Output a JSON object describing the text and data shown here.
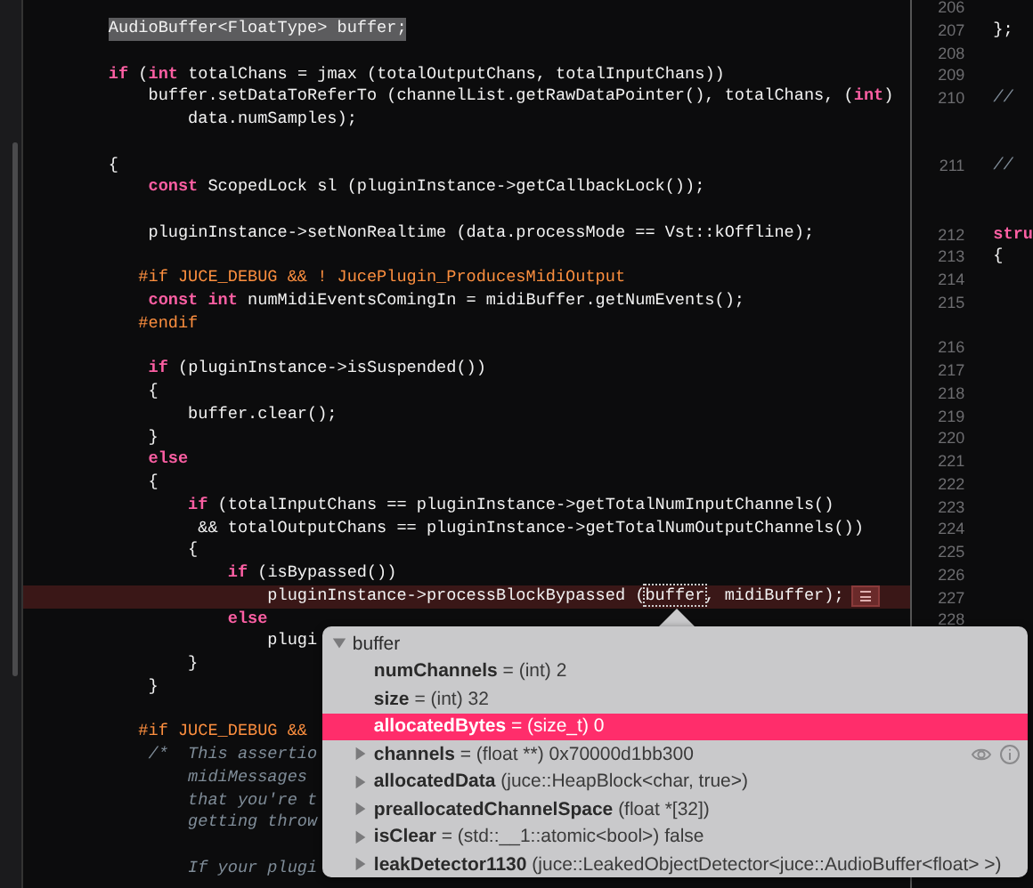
{
  "editor": {
    "lines": [
      {
        "kind": "selected",
        "segments": [
          {
            "kind": "plain",
            "text": "AudioBuffer<FloatType> buffer;"
          }
        ]
      },
      {
        "kind": "blank"
      },
      {
        "kind": "code",
        "segments": [
          {
            "kind": "keyword",
            "text": "if"
          },
          {
            "kind": "plain",
            "text": " ("
          },
          {
            "kind": "keyword",
            "text": "int"
          },
          {
            "kind": "plain",
            "text": " totalChans = jmax (totalOutputChans, totalInputChans))"
          }
        ]
      },
      {
        "kind": "code",
        "segments": [
          {
            "kind": "plain",
            "text": "    buffer.setDataToReferTo (channelList.getRawDataPointer(), totalChans, ("
          },
          {
            "kind": "keyword",
            "text": "int"
          },
          {
            "kind": "plain",
            "text": ")"
          }
        ]
      },
      {
        "kind": "code",
        "segments": [
          {
            "kind": "plain",
            "text": "        data.numSamples);"
          }
        ]
      },
      {
        "kind": "blank"
      },
      {
        "kind": "code",
        "segments": [
          {
            "kind": "plain",
            "text": "{"
          }
        ]
      },
      {
        "kind": "code",
        "segments": [
          {
            "kind": "keyword",
            "text": "    const"
          },
          {
            "kind": "plain",
            "text": " ScopedLock sl (pluginInstance->getCallbackLock());"
          }
        ]
      },
      {
        "kind": "blank"
      },
      {
        "kind": "code",
        "segments": [
          {
            "kind": "plain",
            "text": "    pluginInstance->setNonRealtime (data.processMode == Vst::kOffline);"
          }
        ]
      },
      {
        "kind": "blank"
      },
      {
        "kind": "code",
        "segments": [
          {
            "kind": "preprocessor",
            "text": "   #if JUCE_DEBUG && ! JucePlugin_ProducesMidiOutput"
          }
        ]
      },
      {
        "kind": "code",
        "segments": [
          {
            "kind": "keyword",
            "text": "    const int"
          },
          {
            "kind": "plain",
            "text": " numMidiEventsComingIn = midiBuffer.getNumEvents();"
          }
        ]
      },
      {
        "kind": "code",
        "segments": [
          {
            "kind": "preprocessor",
            "text": "   #endif"
          }
        ]
      },
      {
        "kind": "blank"
      },
      {
        "kind": "code",
        "segments": [
          {
            "kind": "keyword",
            "text": "    if"
          },
          {
            "kind": "plain",
            "text": " (pluginInstance->isSuspended())"
          }
        ]
      },
      {
        "kind": "code",
        "segments": [
          {
            "kind": "plain",
            "text": "    {"
          }
        ]
      },
      {
        "kind": "code",
        "segments": [
          {
            "kind": "plain",
            "text": "        buffer.clear();"
          }
        ]
      },
      {
        "kind": "code",
        "segments": [
          {
            "kind": "plain",
            "text": "    }"
          }
        ]
      },
      {
        "kind": "code",
        "segments": [
          {
            "kind": "keyword",
            "text": "    else"
          }
        ]
      },
      {
        "kind": "code",
        "segments": [
          {
            "kind": "plain",
            "text": "    {"
          }
        ]
      },
      {
        "kind": "code",
        "segments": [
          {
            "kind": "keyword",
            "text": "        if"
          },
          {
            "kind": "plain",
            "text": " (totalInputChans == pluginInstance->getTotalNumInputChannels()"
          }
        ]
      },
      {
        "kind": "code",
        "segments": [
          {
            "kind": "plain",
            "text": "         && totalOutputChans == pluginInstance->getTotalNumOutputChannels())"
          }
        ]
      },
      {
        "kind": "code",
        "segments": [
          {
            "kind": "plain",
            "text": "        {"
          }
        ]
      },
      {
        "kind": "code",
        "segments": [
          {
            "kind": "keyword",
            "text": "            if"
          },
          {
            "kind": "plain",
            "text": " (isBypassed())"
          }
        ]
      },
      {
        "kind": "current",
        "segments": [
          {
            "kind": "plain",
            "text": "                pluginInstance->processBlockBypassed ("
          },
          {
            "kind": "inspected",
            "text": "buffer"
          },
          {
            "kind": "plain",
            "text": ", midiBuffer);"
          },
          {
            "kind": "badge"
          }
        ]
      },
      {
        "kind": "code",
        "segments": [
          {
            "kind": "keyword",
            "text": "            else"
          }
        ]
      },
      {
        "kind": "code",
        "segments": [
          {
            "kind": "plain",
            "text": "                plugi"
          }
        ]
      },
      {
        "kind": "code",
        "segments": [
          {
            "kind": "plain",
            "text": "        }"
          }
        ]
      },
      {
        "kind": "code",
        "segments": [
          {
            "kind": "plain",
            "text": "    }"
          }
        ]
      },
      {
        "kind": "blank"
      },
      {
        "kind": "code",
        "segments": [
          {
            "kind": "preprocessor",
            "text": "   #if JUCE_DEBUG &&"
          }
        ]
      },
      {
        "kind": "code",
        "segments": [
          {
            "kind": "comment",
            "text": "    /*  This assertio"
          }
        ]
      },
      {
        "kind": "code",
        "segments": [
          {
            "kind": "comment",
            "text": "        midiMessages"
          }
        ]
      },
      {
        "kind": "code",
        "segments": [
          {
            "kind": "comment",
            "text": "        that you're t"
          }
        ]
      },
      {
        "kind": "code",
        "segments": [
          {
            "kind": "comment",
            "text": "        getting throw"
          }
        ]
      },
      {
        "kind": "blank"
      },
      {
        "kind": "code",
        "segments": [
          {
            "kind": "comment",
            "text": "        If your plugi"
          }
        ]
      }
    ]
  },
  "side_pane": {
    "rows": [
      {
        "kind": "line",
        "number": "206"
      },
      {
        "kind": "line",
        "number": "207",
        "code": [
          {
            "kind": "plain",
            "text": "};"
          }
        ]
      },
      {
        "kind": "line",
        "number": "208"
      },
      {
        "kind": "line",
        "number": "209"
      },
      {
        "kind": "line",
        "number": "210",
        "code": [
          {
            "kind": "comment",
            "text": "//"
          }
        ]
      },
      {
        "kind": "wrap"
      },
      {
        "kind": "wrap"
      },
      {
        "kind": "line",
        "number": "211",
        "code": [
          {
            "kind": "comment",
            "text": "//"
          }
        ]
      },
      {
        "kind": "wrap"
      },
      {
        "kind": "wrap"
      },
      {
        "kind": "line",
        "number": "212",
        "code": [
          {
            "kind": "keyword",
            "text": "stru"
          }
        ]
      },
      {
        "kind": "line",
        "number": "213",
        "code": [
          {
            "kind": "plain",
            "text": "{"
          }
        ]
      },
      {
        "kind": "line",
        "number": "214"
      },
      {
        "kind": "line",
        "number": "215"
      },
      {
        "kind": "wrap"
      },
      {
        "kind": "line",
        "number": "216"
      },
      {
        "kind": "line",
        "number": "217"
      },
      {
        "kind": "line",
        "number": "218"
      },
      {
        "kind": "line",
        "number": "219"
      },
      {
        "kind": "line",
        "number": "220"
      },
      {
        "kind": "line",
        "number": "221"
      },
      {
        "kind": "line",
        "number": "222"
      },
      {
        "kind": "line",
        "number": "223"
      },
      {
        "kind": "line",
        "number": "224"
      },
      {
        "kind": "line",
        "number": "225"
      },
      {
        "kind": "line",
        "number": "226"
      },
      {
        "kind": "line",
        "number": "227"
      },
      {
        "kind": "line",
        "number": "228"
      }
    ]
  },
  "variables_popover": {
    "name": "buffer",
    "expanded": true,
    "children": [
      {
        "name": "numChannels",
        "detail": "= (int) 2",
        "selected": false
      },
      {
        "name": "size",
        "detail": "= (int) 32",
        "selected": false
      },
      {
        "name": "allocatedBytes",
        "detail": "= (size_t) 0",
        "selected": true
      },
      {
        "name": "channels",
        "detail": "= (float **) 0x70000d1bb300",
        "expanded": false,
        "selected": false,
        "actions": true
      },
      {
        "name": "allocatedData",
        "detail": "(juce::HeapBlock<char, true>)",
        "expanded": false,
        "selected": false
      },
      {
        "name": "preallocatedChannelSpace",
        "detail": "(float *[32])",
        "expanded": false,
        "selected": false
      },
      {
        "name": "isClear",
        "detail": "= (std::__1::atomic<bool>) false",
        "expanded": false,
        "selected": false
      },
      {
        "name": "leakDetector1130",
        "detail": "(juce::LeakedObjectDetector<juce::AudioBuffer<float> >)",
        "expanded": false,
        "selected": false
      }
    ]
  }
}
